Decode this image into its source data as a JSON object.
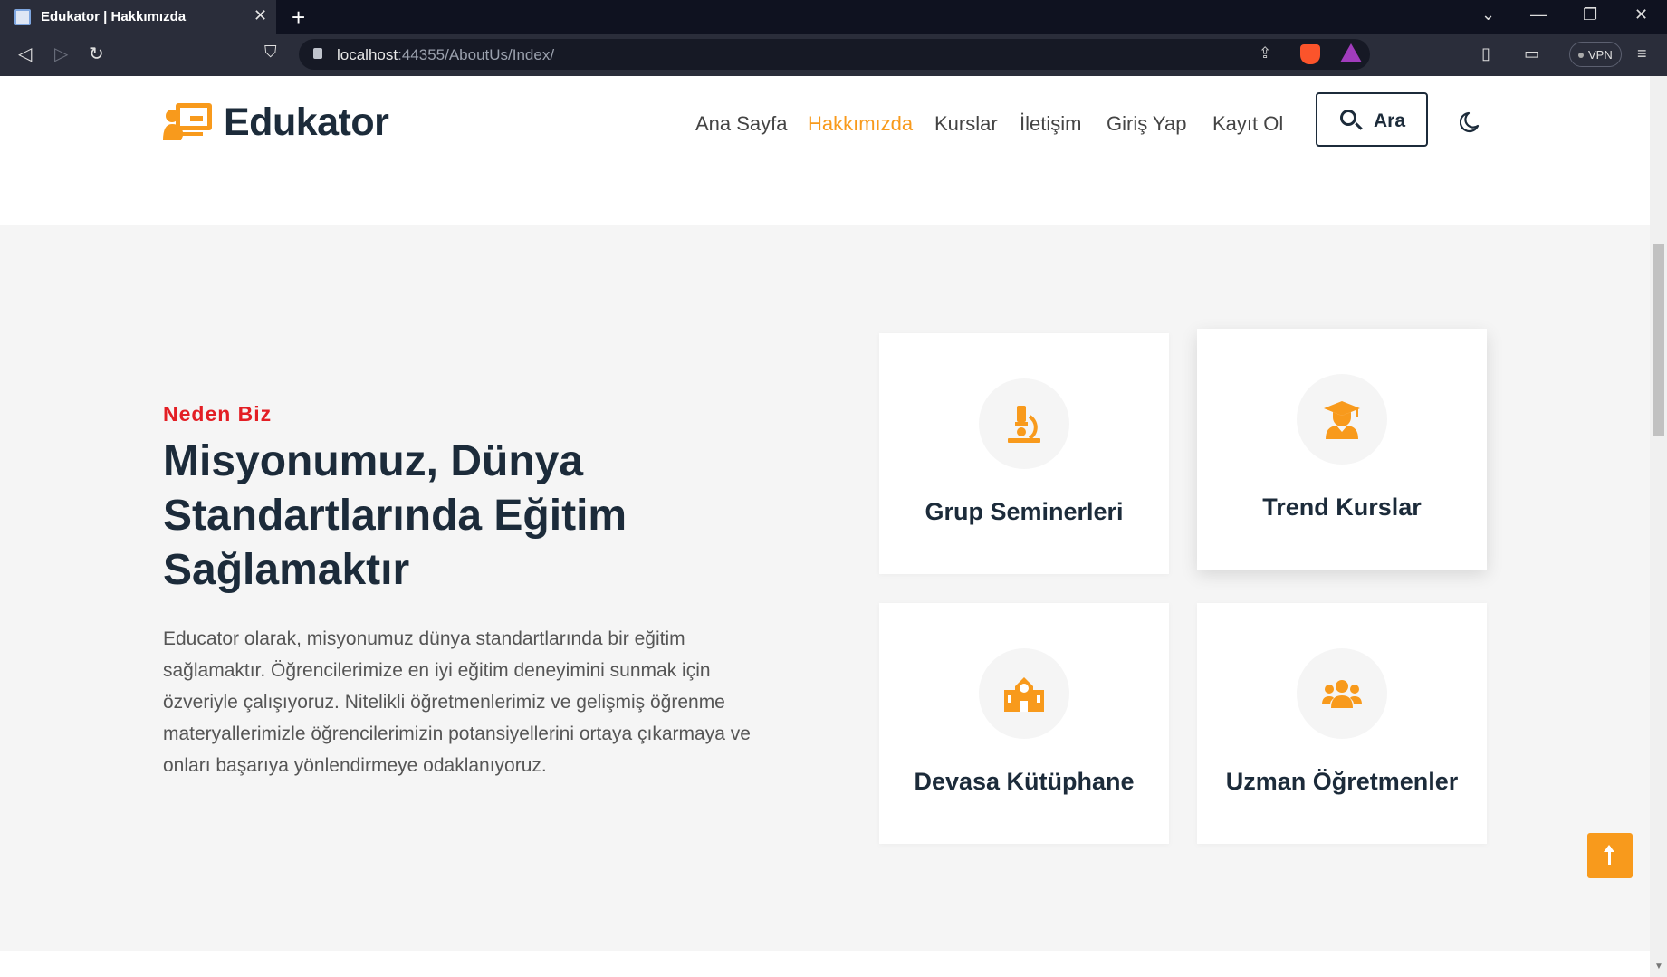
{
  "browser": {
    "tab_title": "Edukator | Hakkımızda",
    "url_host": "localhost",
    "url_rest": ":44355/AboutUs/Index/",
    "vpn_label": "VPN"
  },
  "header": {
    "brand": "Edukator",
    "menu": [
      {
        "label": "Ana Sayfa",
        "active": false
      },
      {
        "label": "Hakkımızda",
        "active": true
      },
      {
        "label": "Kurslar",
        "active": false
      },
      {
        "label": "İletişim",
        "active": false
      },
      {
        "label": "Giriş Yap",
        "active": false
      },
      {
        "label": "Kayıt Ol",
        "active": false
      }
    ],
    "search_label": "Ara"
  },
  "about": {
    "eyebrow": "Neden Biz",
    "headline": "Misyonumuz, Dünya Standartlarında Eğitim Sağlamaktır",
    "description": "Educator olarak, misyonumuz dünya standartlarında bir eğitim sağlamaktır. Öğrencilerimize en iyi eğitim deneyimini sunmak için özveriyle çalışıyoruz. Nitelikli öğretmenlerimiz ve gelişmiş öğrenme materyallerimizle öğrencilerimizin potansiyellerini ortaya çıkarmaya ve onları başarıya yönlendirmeye odaklanıyoruz."
  },
  "features": [
    {
      "label": "Grup Seminerleri",
      "icon": "microscope-icon"
    },
    {
      "label": "Trend Kurslar",
      "icon": "graduate-icon"
    },
    {
      "label": "Devasa Kütüphane",
      "icon": "school-icon"
    },
    {
      "label": "Uzman Öğretmenler",
      "icon": "users-icon"
    }
  ],
  "colors": {
    "accent": "#f89a1c",
    "eyebrow": "#e31e24",
    "heading": "#1c2b3a"
  }
}
